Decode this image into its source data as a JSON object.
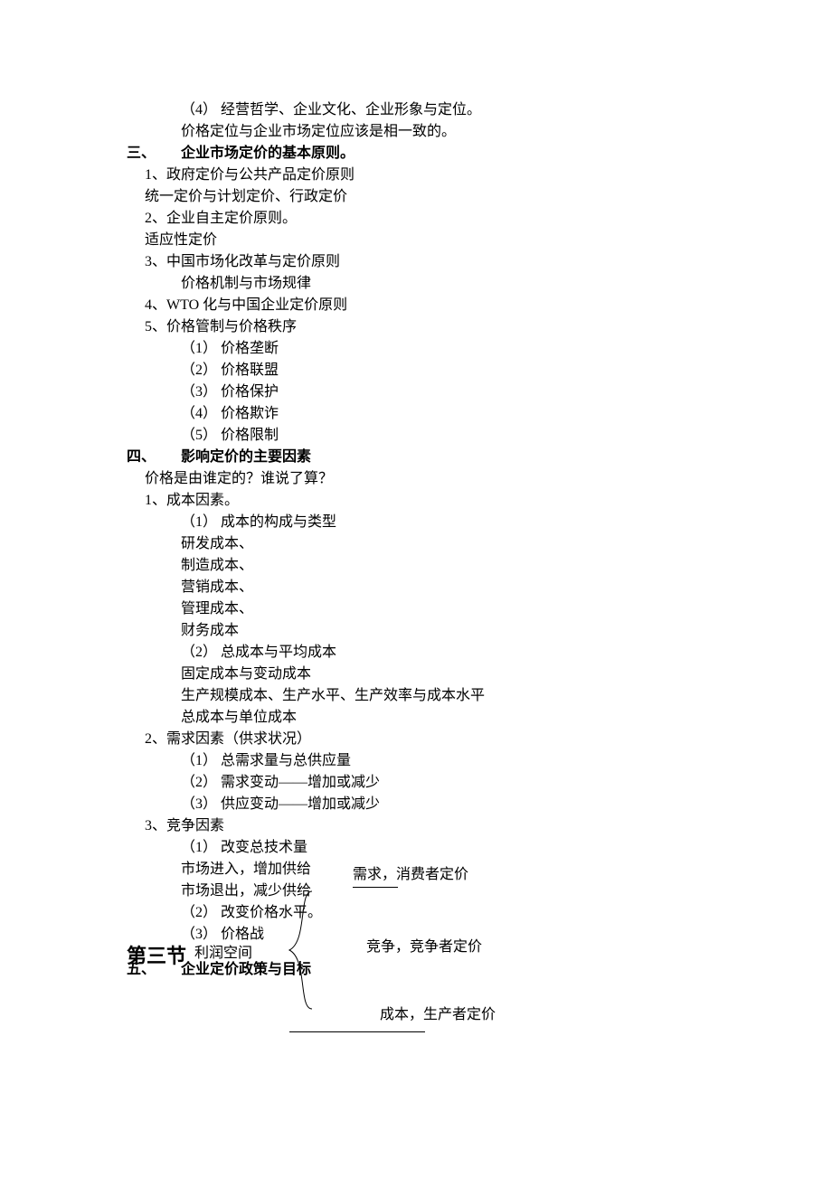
{
  "top": {
    "item4": "（4）  经营哲学、企业文化、企业形象与定位。",
    "note": "价格定位与企业市场定位应该是相一致的。"
  },
  "section3": {
    "num": "三、",
    "title": "企业市场定价的基本原则。",
    "p1": "1、政府定价与公共产品定价原则",
    "p1a": "统一定价与计划定价、行政定价",
    "p2": "2、企业自主定价原则。",
    "p2a": "适应性定价",
    "p3": "3、中国市场化改革与定价原则",
    "p3a": "价格机制与市场规律",
    "p4": "4、WTO 化与中国企业定价原则",
    "p5": "5、价格管制与价格秩序",
    "p5_1": "（1）  价格垄断",
    "p5_2": "（2）  价格联盟",
    "p5_3": "（3）  价格保护",
    "p5_4": "（4）  价格欺诈",
    "p5_5": "（5）  价格限制"
  },
  "section4": {
    "num": "四、",
    "title": "影响定价的主要因素",
    "intro": "价格是由谁定的？谁说了算？",
    "p1": "1、成本因素。",
    "p1_1": "（1）  成本的构成与类型",
    "p1_1a": "研发成本、",
    "p1_1b": "制造成本、",
    "p1_1c": "营销成本、",
    "p1_1d": "管理成本、",
    "p1_1e": "财务成本",
    "p1_2": "（2）  总成本与平均成本",
    "p1_2a": "固定成本与变动成本",
    "p1_2b": "生产规模成本、生产水平、生产效率与成本水平",
    "p1_2c": "总成本与单位成本",
    "p2": "2、需求因素（供求状况）",
    "p2_1": "（1）  总需求量与总供应量",
    "p2_2": "（2）  需求变动——增加或减少",
    "p2_3": "（3）  供应变动——增加或减少",
    "p3": "3、竞争因素",
    "p3_1": "（1）  改变总技术量",
    "p3_1a": "市场进入，增加供给",
    "p3_1b": "市场退出，减少供给",
    "p3_2": "（2）  改变价格水平。",
    "p3_3": "（3）  价格战"
  },
  "diagram": {
    "section_title": "第三节",
    "profit": "利润空间",
    "demand": "需求，消费者定价",
    "competition": "竞争，竞争者定价",
    "cost": "成本，生产者定价"
  },
  "section5": {
    "num": "五、",
    "title": "企业定价政策与目标"
  }
}
